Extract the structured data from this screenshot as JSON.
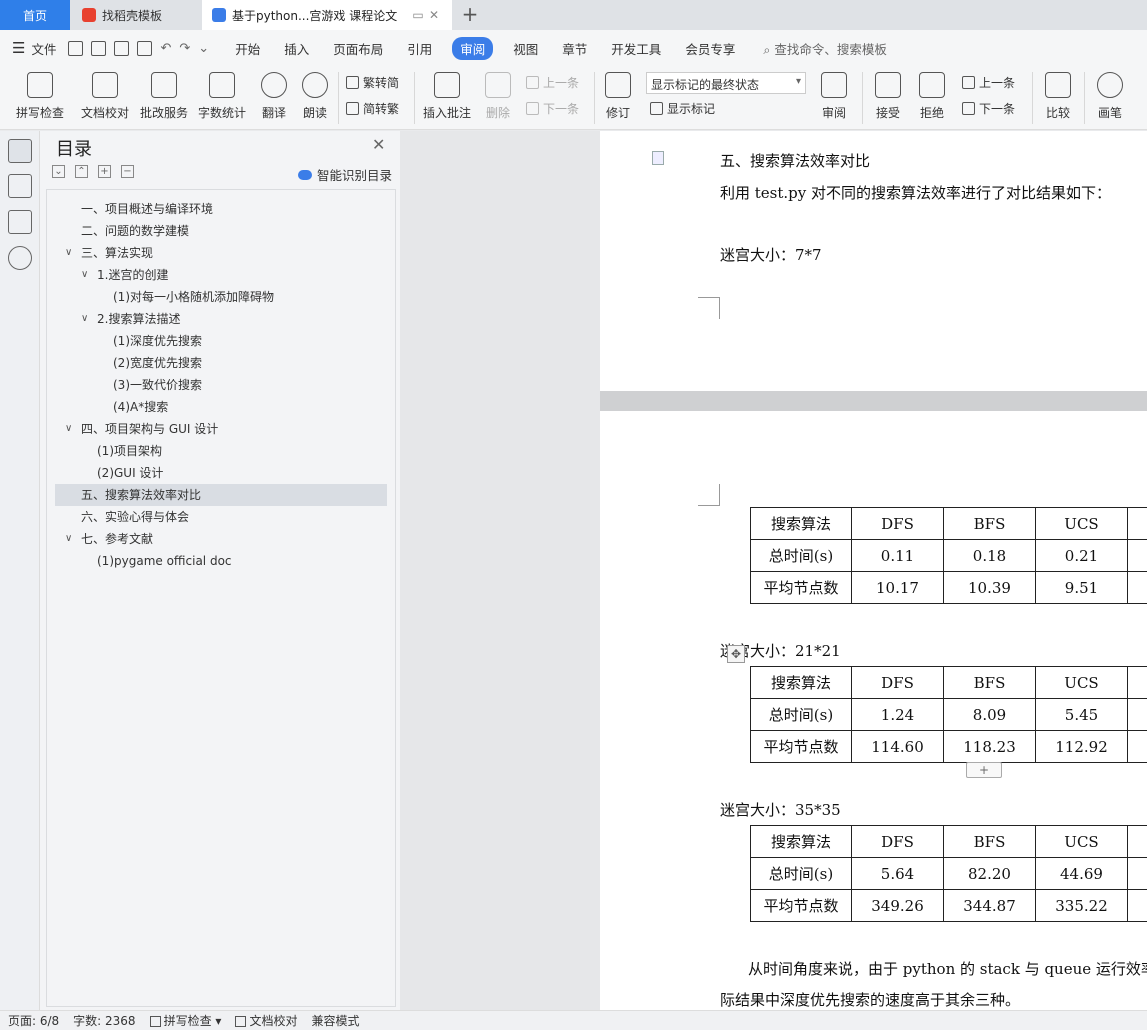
{
  "tabs": {
    "home": "首页",
    "template": "找稻壳模板",
    "doc": "基于python...宫游戏 课程论文",
    "new": "+"
  },
  "menu": {
    "file": "文件",
    "tabs": [
      "开始",
      "插入",
      "页面布局",
      "引用",
      "审阅",
      "视图",
      "章节",
      "开发工具",
      "会员专享"
    ],
    "active_tab": "审阅",
    "search": "查找命令、搜索模板"
  },
  "ribbon": {
    "spellcheck": "拼写检查",
    "doc_proof": "文档校对",
    "revise_service": "批改服务",
    "word_count": "字数统计",
    "translate": "翻译",
    "read_aloud": "朗读",
    "trad_conv": "繁转简",
    "simp_conv": "简转繁",
    "insert_comment": "插入批注",
    "delete": "删除",
    "prev": "上一条",
    "next": "下一条",
    "revise": "修订",
    "markup_select": "显示标记的最终状态",
    "show_markup": "显示标记",
    "review": "审阅",
    "accept": "接受",
    "reject": "拒绝",
    "prev2": "上一条",
    "next2": "下一条",
    "compare": "比较",
    "pen": "画笔"
  },
  "toc": {
    "title": "目录",
    "smart": "智能识别目录",
    "items": [
      "一、项目概述与编译环境",
      "二、问题的数学建模",
      "三、算法实现",
      "1.迷宫的创建",
      "(1)对每一小格随机添加障碍物",
      "2.搜索算法描述",
      "(1)深度优先搜索",
      "(2)宽度优先搜索",
      "(3)一致代价搜索",
      "(4)A*搜索",
      "四、项目架构与 GUI 设计",
      "(1)项目架构",
      "(2)GUI 设计",
      "五、搜索算法效率对比",
      "六、实验心得与体会",
      "七、参考文献",
      "(1)pygame official doc"
    ]
  },
  "doc": {
    "heading": "五、搜索算法效率对比",
    "intro": "利用 test.py 对不同的搜索算法效率进行了对比结果如下：",
    "maze1": "迷宫大小：7*7",
    "maze2": "迷宫大小：21*21",
    "maze3": "迷宫大小：35*35",
    "header": [
      "搜索算法",
      "DFS",
      "BFS",
      "UCS"
    ],
    "row_labels": [
      "总时间(s)",
      "平均节点数"
    ],
    "t1": [
      [
        "0.11",
        "0.18",
        "0.21"
      ],
      [
        "10.17",
        "10.39",
        "9.51"
      ]
    ],
    "t2": [
      [
        "1.24",
        "8.09",
        "5.45"
      ],
      [
        "114.60",
        "118.23",
        "112.92"
      ]
    ],
    "t3": [
      [
        "5.64",
        "82.20",
        "44.69"
      ],
      [
        "349.26",
        "344.87",
        "335.22"
      ]
    ],
    "para1": "从时间角度来说，由于 python 的 stack 与 queue 运行效率",
    "para2": "际结果中深度优先搜索的速度高于其余三种。"
  },
  "status": {
    "page": "页面: 6/8",
    "words": "字数: 2368",
    "spell": "拼写检查",
    "proof": "文档校对",
    "mode": "兼容模式"
  }
}
